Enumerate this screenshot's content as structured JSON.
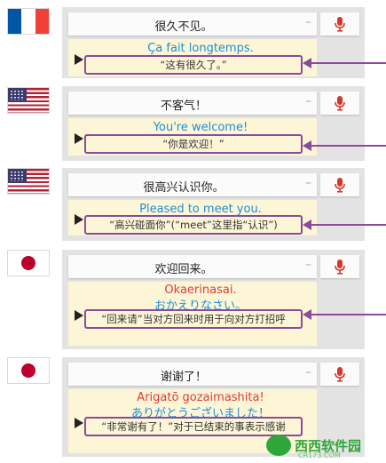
{
  "entries": [
    {
      "flag": "france",
      "source": "很久不见。",
      "translation": "Ça fait longtemps.",
      "translation_color": "blue",
      "note": "“这有很久了。”"
    },
    {
      "flag": "usa",
      "source": "不客气！",
      "translation": "You're welcome!",
      "translation_color": "blue",
      "note": "“你是欢迎！”"
    },
    {
      "flag": "usa",
      "source": "很高兴认识你。",
      "translation": "Pleased to meet you.",
      "translation_color": "blue",
      "note": "“高兴碰面你”(“meet”这里指“认识”)"
    },
    {
      "flag": "japan",
      "source": "欢迎回来。",
      "translation": "Okaerinasai.",
      "translation_color": "red",
      "translation_kana": "おかえりなさい。",
      "note": "“回来请”当对方回来时用于向对方打招呼"
    },
    {
      "flag": "japan",
      "source": "谢谢了！",
      "translation": "Arigatō gozaimashita!",
      "translation_color": "red",
      "translation_kana": "ありがとうございました！",
      "note": "“非常谢有了！”对于已结束的事表示感谢"
    }
  ],
  "ui": {
    "minus_glyph": "–",
    "mic_icon": "microphone-icon",
    "play_icon": "play-icon"
  },
  "watermark": {
    "brand": "西西软件园",
    "site": "CR173.COM"
  },
  "colors": {
    "panel_bg": "#e3e3e3",
    "result_bg": "#fcf6d6",
    "highlight": "#8b4a9c",
    "translation_blue": "#1f8dd6",
    "translation_red": "#e03a3a",
    "mic_red": "#d9362b",
    "watermark_green": "#2fa63a"
  }
}
